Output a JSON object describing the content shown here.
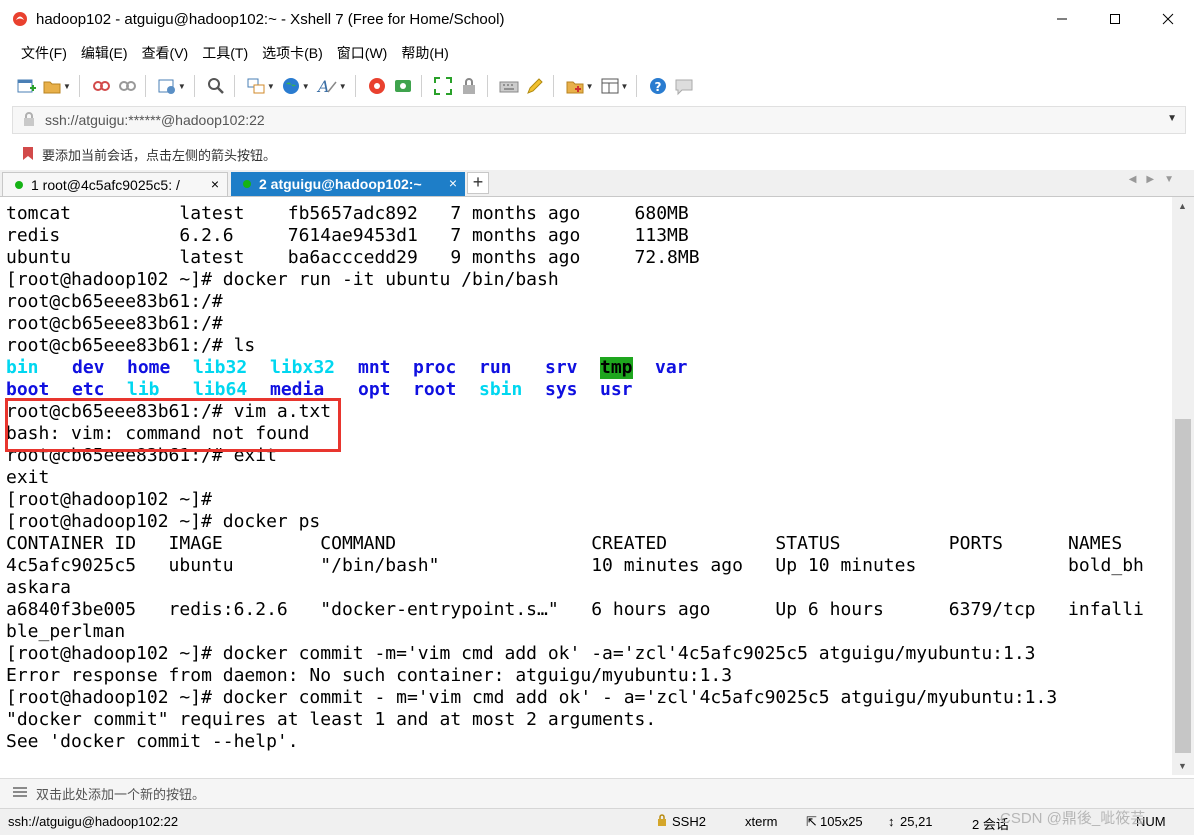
{
  "window": {
    "title": "hadoop102 - atguigu@hadoop102:~ - Xshell 7 (Free for Home/School)"
  },
  "menu": [
    "文件(F)",
    "编辑(E)",
    "查看(V)",
    "工具(T)",
    "选项卡(B)",
    "窗口(W)",
    "帮助(H)"
  ],
  "address": {
    "text": "ssh://atguigu:******@hadoop102:22"
  },
  "hint": {
    "text": "要添加当前会话，点击左侧的箭头按钮。"
  },
  "tabs": [
    {
      "label": "1 root@4c5afc9025c5: /",
      "active": false,
      "close": "×"
    },
    {
      "label": "2 atguigu@hadoop102:~",
      "active": true,
      "close": "×"
    }
  ],
  "tab_add": "+",
  "terminal": {
    "lines": [
      "tomcat          latest    fb5657adc892   7 months ago     680MB",
      "redis           6.2.6     7614ae9453d1   7 months ago     113MB",
      "ubuntu          latest    ba6acccedd29   9 months ago     72.8MB",
      "[root@hadoop102 ~]# docker run -it ubuntu /bin/bash",
      "root@cb65eee83b61:/#",
      "root@cb65eee83b61:/#",
      "root@cb65eee83b61:/# ls"
    ],
    "ls_rows": [
      [
        {
          "name": "bin",
          "color": "#00d7f0"
        },
        {
          "name": "dev",
          "color": "#1010e0"
        },
        {
          "name": "home",
          "color": "#1010e0"
        },
        {
          "name": "lib32",
          "color": "#00d7f0"
        },
        {
          "name": "libx32",
          "color": "#00d7f0"
        },
        {
          "name": "mnt",
          "color": "#1010e0"
        },
        {
          "name": "proc",
          "color": "#1010e0"
        },
        {
          "name": "run",
          "color": "#1010e0"
        },
        {
          "name": "srv",
          "color": "#1010e0"
        },
        {
          "name": "tmp",
          "color": "#000000",
          "bg": "#1ea61e"
        },
        {
          "name": "var",
          "color": "#1010e0"
        }
      ],
      [
        {
          "name": "boot",
          "color": "#1010e0"
        },
        {
          "name": "etc",
          "color": "#1010e0"
        },
        {
          "name": "lib",
          "color": "#00d7f0"
        },
        {
          "name": "lib64",
          "color": "#00d7f0"
        },
        {
          "name": "media",
          "color": "#1010e0"
        },
        {
          "name": "opt",
          "color": "#1010e0"
        },
        {
          "name": "root",
          "color": "#1010e0"
        },
        {
          "name": "sbin",
          "color": "#00d7f0"
        },
        {
          "name": "sys",
          "color": "#1010e0"
        },
        {
          "name": "usr",
          "color": "#1010e0"
        }
      ]
    ],
    "lines_after": [
      "root@cb65eee83b61:/# vim a.txt",
      "bash: vim: command not found",
      "root@cb65eee83b61:/# exit",
      "exit",
      "[root@hadoop102 ~]#",
      "[root@hadoop102 ~]# docker ps",
      "CONTAINER ID   IMAGE         COMMAND                  CREATED          STATUS          PORTS      NAMES",
      "4c5afc9025c5   ubuntu        \"/bin/bash\"              10 minutes ago   Up 10 minutes              bold_bh",
      "askara",
      "a6840f3be005   redis:6.2.6   \"docker-entrypoint.s…\"   6 hours ago      Up 6 hours      6379/tcp   infalli",
      "ble_perlman",
      "[root@hadoop102 ~]# docker commit -m='vim cmd add ok' -a='zcl'4c5afc9025c5 atguigu/myubuntu:1.3",
      "Error response from daemon: No such container: atguigu/myubuntu:1.3",
      "[root@hadoop102 ~]# docker commit - m='vim cmd add ok' - a='zcl'4c5afc9025c5 atguigu/myubuntu:1.3",
      "\"docker commit\" requires at least 1 and at most 2 arguments.",
      "See 'docker commit --help'."
    ]
  },
  "quickbar": {
    "text": "双击此处添加一个新的按钮。"
  },
  "status": {
    "connection": "ssh://atguigu@hadoop102:22",
    "protocol": "SSH2",
    "terminal_type": "xterm",
    "size": "105x25",
    "cursor": "25,21",
    "sessions": "2 会话",
    "num": "NUM"
  },
  "watermark": "CSDN @鼎後_呲筱芸",
  "colors": {
    "tab_active": "#1e7ec8",
    "highlight": "#e8352e",
    "ls_dir": "#1010e0",
    "ls_link": "#00d7f0",
    "ls_tmp_bg": "#1ea61e"
  }
}
